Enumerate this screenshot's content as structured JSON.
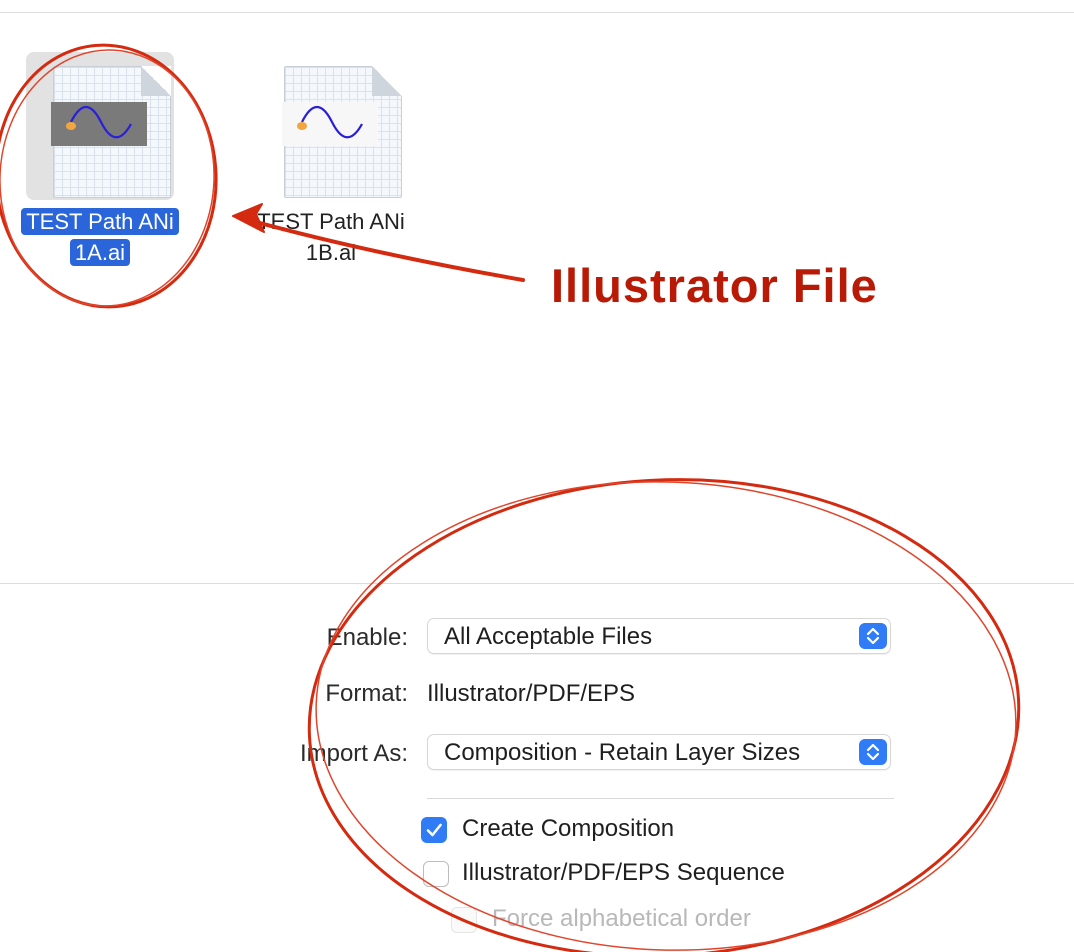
{
  "files": [
    {
      "name": "TEST Path ANi 1A.ai",
      "name_line1": "TEST Path ANi",
      "name_line2": "1A.ai",
      "selected": true,
      "icon": "illustrator-file-icon"
    },
    {
      "name": "TEST Path ANi 1B.ai",
      "name_line1": "TEST Path ANi",
      "name_line2": "1B.ai",
      "selected": false,
      "icon": "illustrator-file-icon"
    }
  ],
  "annotation": {
    "callout": "Illustrator File",
    "color": "#d42a10"
  },
  "options": {
    "enable_label": "Enable:",
    "enable_value": "All Acceptable Files",
    "format_label": "Format:",
    "format_value": "Illustrator/PDF/EPS",
    "import_as_label": "Import As:",
    "import_as_value": "Composition - Retain Layer Sizes",
    "checkboxes": [
      {
        "label": "Create Composition",
        "checked": true,
        "enabled": true
      },
      {
        "label": "Illustrator/PDF/EPS Sequence",
        "checked": false,
        "enabled": true
      },
      {
        "label": "Force alphabetical order",
        "checked": false,
        "enabled": false
      }
    ]
  },
  "colors": {
    "accent": "#2f7cf6",
    "selection": "#2a66d9"
  }
}
